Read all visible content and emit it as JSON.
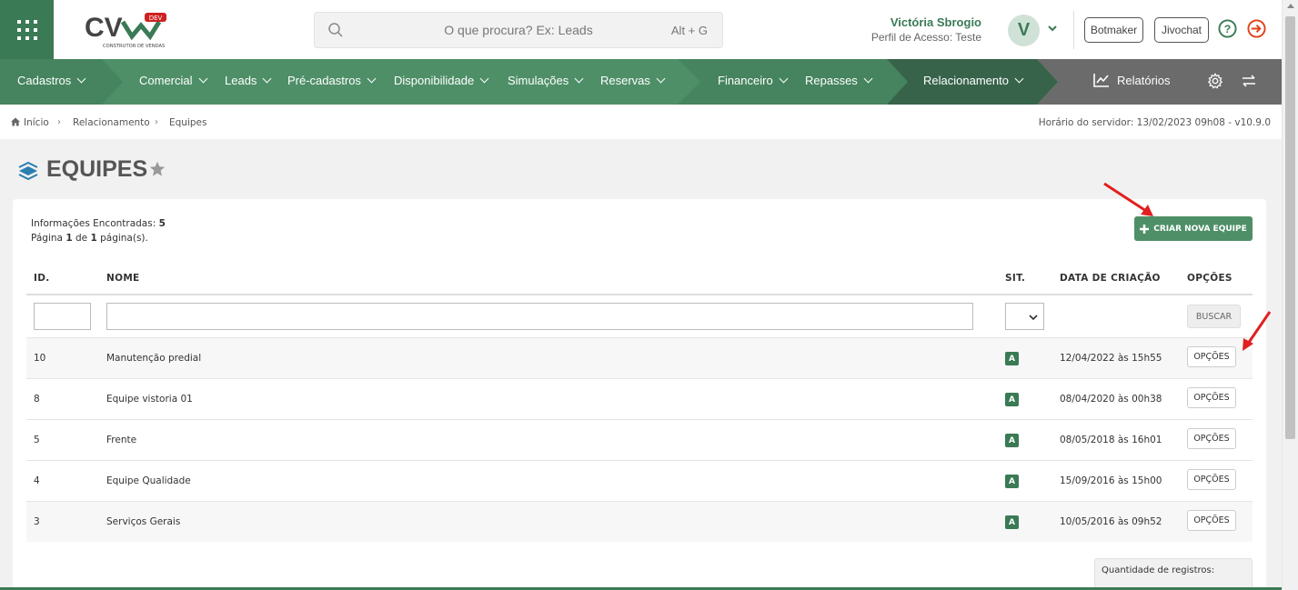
{
  "header": {
    "logo_text": "CV",
    "logo_badge": "DEV",
    "logo_sub": "CONSTRUTOR DE VENDAS",
    "search_placeholder": "O que procura? Ex: Leads",
    "search_shortcut": "Alt + G",
    "user_name": "Victória Sbrogio",
    "user_role": "Perfil de Acesso: Teste",
    "avatar_initial": "V",
    "botmaker_label": "Botmaker",
    "jivochat_label": "Jivochat"
  },
  "nav": {
    "items": [
      {
        "label": "Cadastros"
      },
      {
        "label": "Comercial"
      },
      {
        "label": "Leads"
      },
      {
        "label": "Pré-cadastros"
      },
      {
        "label": "Disponibilidade"
      },
      {
        "label": "Simulações"
      },
      {
        "label": "Reservas"
      },
      {
        "label": "Financeiro"
      },
      {
        "label": "Repasses"
      },
      {
        "label": "Relacionamento"
      }
    ],
    "reports_label": "Relatórios"
  },
  "breadcrumb": {
    "home": "Início",
    "section": "Relacionamento",
    "current": "Equipes",
    "server_time": "Horário do servidor: 13/02/2023 09h08 - v10.9.0"
  },
  "page": {
    "title": "EQUIPES",
    "info_found_label": "Informações Encontradas:",
    "info_found_count": "5",
    "page_word": "Página",
    "page_current": "1",
    "page_of": "de",
    "page_total": "1",
    "page_suffix": "página(s).",
    "create_button": "CRIAR NOVA EQUIPE"
  },
  "table": {
    "headers": {
      "id": "ID.",
      "name": "NOME",
      "sit": "SIT.",
      "date": "DATA DE CRIAÇÃO",
      "options": "OPÇÕES"
    },
    "search_button": "BUSCAR",
    "option_button": "OPÇÕES",
    "rows": [
      {
        "id": "10",
        "name": "Manutenção predial",
        "status": "A",
        "date": "12/04/2022 às 15h55"
      },
      {
        "id": "8",
        "name": "Equipe vistoria 01",
        "status": "A",
        "date": "08/04/2020 às 00h38"
      },
      {
        "id": "5",
        "name": "Frente",
        "status": "A",
        "date": "08/05/2018 às 16h01"
      },
      {
        "id": "4",
        "name": "Equipe Qualidade",
        "status": "A",
        "date": "15/09/2016 às 15h00"
      },
      {
        "id": "3",
        "name": "Serviços Gerais",
        "status": "A",
        "date": "10/05/2016 às 09h52"
      }
    ],
    "quantity_label": "Quantidade de registros:"
  },
  "colors": {
    "brand_green": "#3a7a55",
    "nav_green": "#4e8f68",
    "nav_dark": "#37634a",
    "nav_gray": "#6b6b6b",
    "annotation_red": "#e02020"
  }
}
